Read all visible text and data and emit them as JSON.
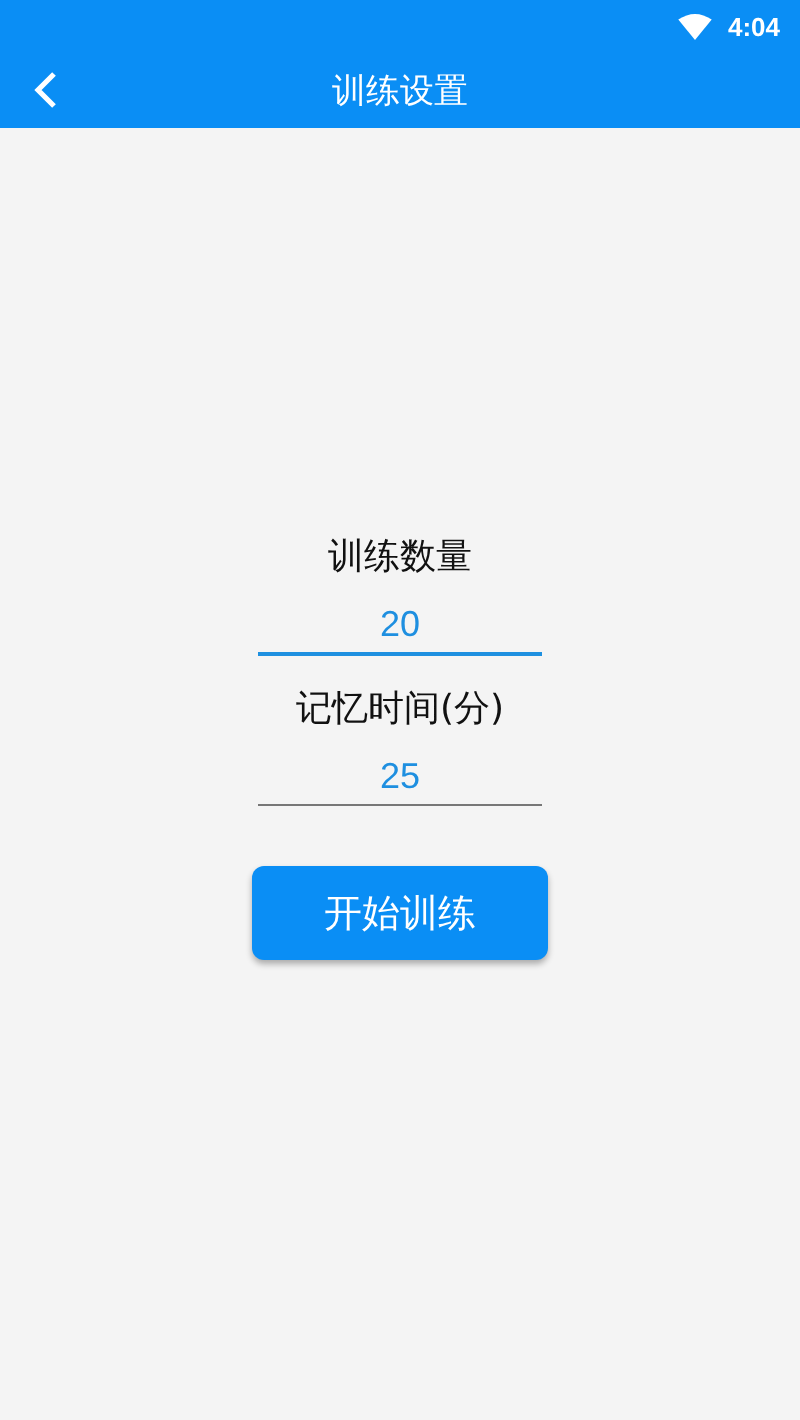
{
  "status_bar": {
    "time": "4:04"
  },
  "app_bar": {
    "title": "训练设置"
  },
  "fields": [
    {
      "label": "训练数量",
      "value": "20",
      "focused": true
    },
    {
      "label": "记忆时间(分)",
      "value": "25",
      "focused": false
    }
  ],
  "button": {
    "label": "开始训练"
  }
}
